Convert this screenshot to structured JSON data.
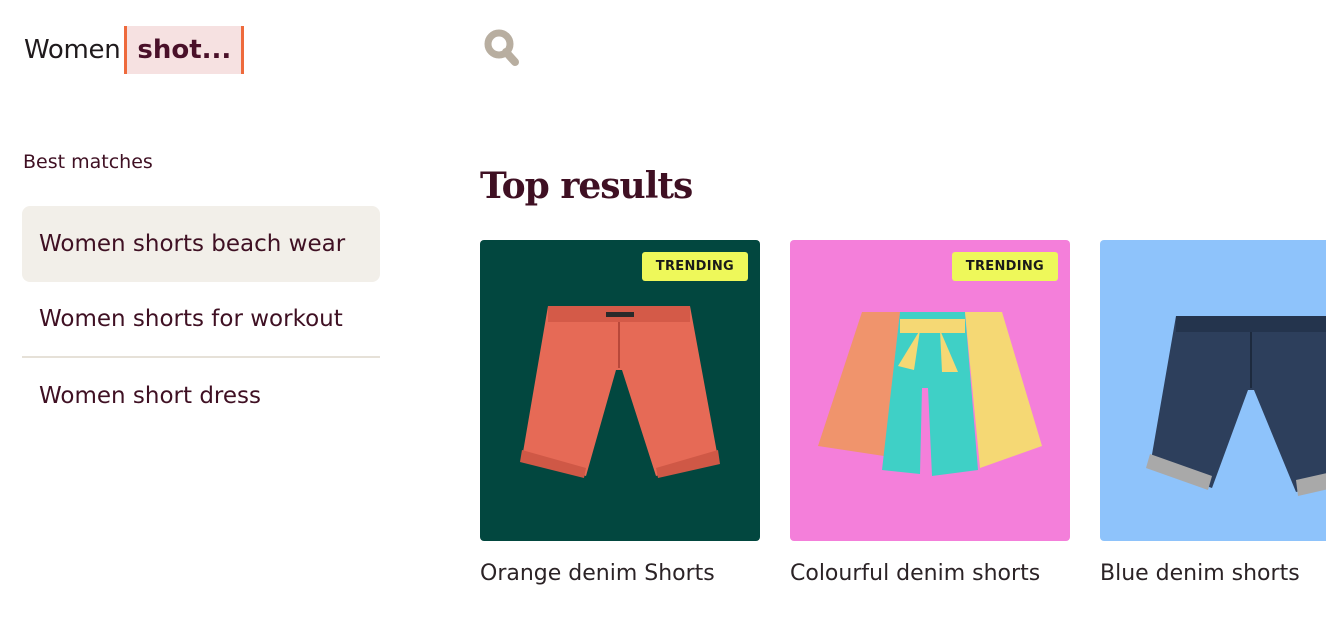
{
  "search": {
    "query_plain": "Women",
    "query_highlight": "shot..."
  },
  "icons": {
    "search": "search-icon"
  },
  "suggestions": {
    "label": "Best matches",
    "items": [
      {
        "label": "Women shorts beach wear",
        "active": true
      },
      {
        "label": "Women shorts for workout",
        "active": false
      },
      {
        "label": "Women short dress",
        "active": false
      }
    ]
  },
  "results": {
    "title": "Top results",
    "items": [
      {
        "name": "Orange denim Shorts",
        "badge": "TRENDING",
        "bg": "#02473f"
      },
      {
        "name": "Colourful denim shorts",
        "badge": "TRENDING",
        "bg": "#f47fda"
      },
      {
        "name": "Blue denim shorts",
        "badge": "",
        "bg": "#8ec3fb"
      }
    ]
  },
  "colors": {
    "text_primary": "#3f1023",
    "highlight_bg": "#f6e1e1",
    "highlight_border": "#ee6a3c",
    "badge_bg": "#eef85a",
    "active_suggestion_bg": "#f2efe9"
  }
}
